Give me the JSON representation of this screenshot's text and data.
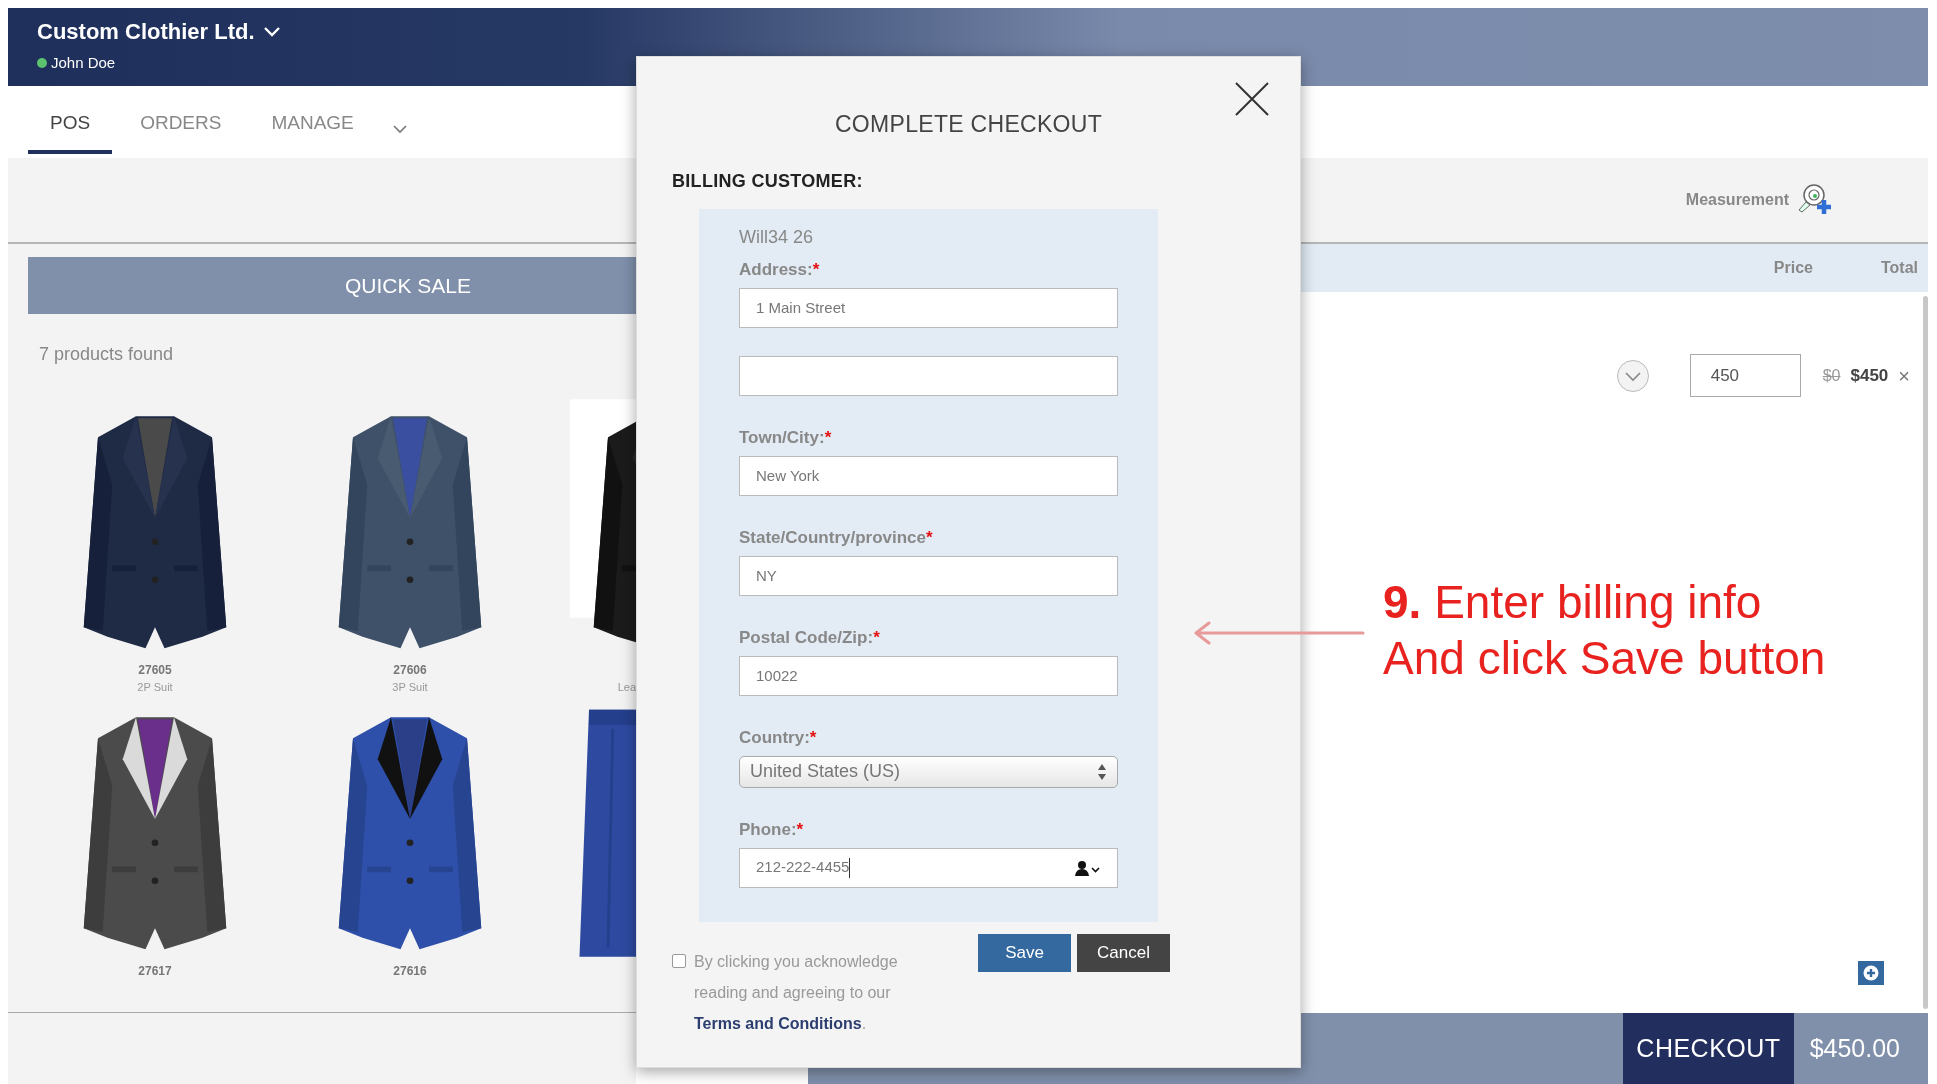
{
  "header": {
    "company": "Custom Clothier Ltd.",
    "user": "John Doe",
    "online": true
  },
  "tabs": [
    {
      "label": "POS",
      "selected": true,
      "dropdown": false
    },
    {
      "label": "ORDERS",
      "selected": false,
      "dropdown": false
    },
    {
      "label": "MANAGE",
      "selected": false,
      "dropdown": true
    }
  ],
  "toolbar": {
    "measurement": "Measurement"
  },
  "quick_sale": {
    "title": "QUICK SALE",
    "count": "7 products found",
    "products": [
      {
        "kind": "picture",
        "code": "27605",
        "type": "2P Suit"
      },
      {
        "kind": "picture",
        "code": "27606",
        "type": "3P Suit"
      },
      {
        "kind": "picture",
        "type": "Lea"
      },
      {
        "kind": "picture",
        "code": "27617"
      },
      {
        "kind": "picture",
        "code": "27616"
      },
      {
        "kind": "picture"
      }
    ]
  },
  "cart": {
    "columns": [
      "Price",
      "Total"
    ],
    "items": [
      {
        "price": "450",
        "list_price": "$0",
        "total": "$450",
        "remove": "×"
      }
    ],
    "checkout": "CHECKOUT",
    "amount": "$450.00"
  },
  "modal": {
    "title": "COMPLETE CHECKOUT",
    "section": "BILLING CUSTOMER:",
    "customer": "Will34 26",
    "fields": [
      {
        "kind": "input",
        "label": "Address:",
        "required": "*",
        "value": "1 Main Street"
      },
      {
        "kind": "input"
      },
      {
        "kind": "input",
        "label": "Town/City:",
        "required": "*",
        "value": "New York"
      },
      {
        "kind": "input",
        "label": "State/Country/province",
        "required": "*",
        "value": "NY"
      },
      {
        "kind": "input",
        "label": "Postal Code/Zip:",
        "required": "*",
        "value": "10022"
      },
      {
        "kind": "select",
        "label": "Country:",
        "required": "*",
        "value": "United States (US)"
      },
      {
        "kind": "phone",
        "label": "Phone:",
        "required": "*",
        "value": "212-222-4455",
        "focused": true
      }
    ],
    "terms": {
      "checked": false,
      "text": "By clicking you acknowledge reading and agreeing to our",
      "link": "Terms and Conditions",
      "end": "."
    },
    "buttons": [
      {
        "label": "Save",
        "kind": "primary"
      },
      {
        "label": "Cancel",
        "kind": "secondary"
      }
    ]
  },
  "annotation": {
    "lines": [
      "**9.** Enter billing info",
      "And click Save button"
    ]
  }
}
